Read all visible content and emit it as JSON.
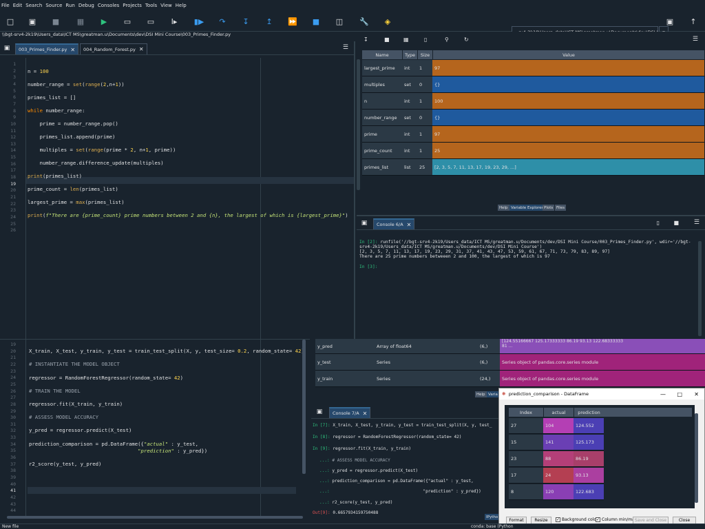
{
  "menu": [
    "File",
    "Edit",
    "Search",
    "Source",
    "Run",
    "Debug",
    "Consoles",
    "Projects",
    "Tools",
    "View",
    "Help"
  ],
  "toolbar": {
    "path": "...rv4-2k19\\Users_data\\ICT MS\\greatman.u\\Documents\\dev\\DSI Mini Course",
    "icons": [
      "new-file-icon",
      "open-folder-icon",
      "save-icon",
      "save-all-icon",
      "run-icon",
      "run-cell-icon",
      "run-cell-advance-icon",
      "run-selection-icon",
      "debug-icon",
      "step-icon",
      "step-into-icon",
      "step-return-icon",
      "continue-icon",
      "stop-icon",
      "maximize-pane-icon",
      "preferences-icon",
      "python-path-icon"
    ]
  },
  "breadcrumb": "\\\\bgt-srv4-2k19\\Users_data\\ICT MS\\greatman.u\\Documents\\dev\\DSI Mini Course\\003_Primes_Finder.py",
  "editor_top": {
    "tabs": [
      "003_Primes_Finder.py",
      "004_Random_Forest.py"
    ],
    "line_numbers": [
      "1",
      "2",
      "3",
      "4",
      "5",
      "6",
      "7",
      "8",
      "9",
      "10",
      "11",
      "12",
      "13",
      "14",
      "15",
      "16",
      "17",
      "18",
      "19",
      "20",
      "21",
      "22",
      "23",
      "24",
      "25",
      "26"
    ],
    "current_line": "19"
  },
  "editor_bottom": {
    "line_numbers": [
      "19",
      "20",
      "21",
      "22",
      "23",
      "24",
      "25",
      "26",
      "27",
      "28",
      "29",
      "30",
      "31",
      "32",
      "33",
      "34",
      "35",
      "36",
      "37",
      "38",
      "39",
      "40",
      "41",
      "42",
      "43",
      "44"
    ],
    "current_line": "41"
  },
  "var_explorer": {
    "toolbar_icons": [
      "import-data-icon",
      "save-data-icon",
      "save-as-icon",
      "delete-icon",
      "search-icon",
      "refresh-icon"
    ],
    "headers": [
      "Name",
      "Type",
      "Size",
      "Value"
    ],
    "rows": [
      {
        "name": "largest_prime",
        "type": "int",
        "size": "1",
        "value": "97",
        "color": "#b5651d"
      },
      {
        "name": "multiples",
        "type": "set",
        "size": "0",
        "value": "{}",
        "color": "#1f5a9e"
      },
      {
        "name": "n",
        "type": "int",
        "size": "1",
        "value": "100",
        "color": "#b5651d"
      },
      {
        "name": "number_range",
        "type": "set",
        "size": "0",
        "value": "{}",
        "color": "#1f5a9e"
      },
      {
        "name": "prime",
        "type": "int",
        "size": "1",
        "value": "97",
        "color": "#b5651d"
      },
      {
        "name": "prime_count",
        "type": "int",
        "size": "1",
        "value": "25",
        "color": "#b5651d"
      },
      {
        "name": "primes_list",
        "type": "list",
        "size": "25",
        "value": "[2, 3, 5, 7, 11, 13, 17, 19, 23, 29, ...]",
        "color": "#2e8fa8"
      }
    ],
    "pane_tabs": [
      "Help",
      "Variable Explorer",
      "Plots",
      "Files"
    ]
  },
  "console_top": {
    "tab": "Console 6/A",
    "line1_prompt": "In [2]:",
    "line1": "runfile('//bgt-srv4-2k19/Users_data/ICT MS/greatman.u/Documents/dev/DSI Mini Course/003_Primes_Finder.py', wdir='//bgt-",
    "line2": "srv4-2k19/Users_data/ICT MS/greatman.u/Documents/dev/DSI Mini Course')",
    "line3": "[2, 3, 5, 7, 11, 13, 17, 19, 23, 29, 31, 37, 41, 43, 47, 53, 59, 61, 67, 71, 73, 79, 83, 89, 97]",
    "line4": "There are 25 prime numbers betweeen 2 and 100, the largest of which is 97",
    "prompt3": "In [3]:"
  },
  "var_explorer2": {
    "rows": [
      {
        "name": "y_pred",
        "type": "Array of float64",
        "size": "(6,)",
        "value": "[124.55166667 125.17333333  86.19        93.13       122.68333333",
        "value2": "81 ..."
      },
      {
        "name": "y_test",
        "type": "Series",
        "size": "(6,)",
        "value": "Series object of pandas.core.series module"
      },
      {
        "name": "y_train",
        "type": "Series",
        "size": "(24,)",
        "value": "Series object of pandas.core.series module"
      }
    ],
    "pane_tabs": [
      "Help",
      "Varia"
    ]
  },
  "console_bottom": {
    "tab": "Console 7/A",
    "lines": [
      {
        "p": "In [7]:",
        "t": "X_train, X_test, y_train, y_test = train_test_split(X, y, test_"
      },
      {
        "p": "In [8]:",
        "t": "regressor = RandomForestRegressor(random_state= 42)"
      },
      {
        "p": "In [9]:",
        "t": "regressor.fit(X_train, y_train)"
      },
      {
        "p": "...:",
        "t": "# ASSESS MODEL ACCURACY"
      },
      {
        "p": "...:",
        "t": "y_pred = regressor.predict(X_test)"
      },
      {
        "p": "...:",
        "t": "prediction_comparison = pd.DataFrame({\"actual\" : y_test,"
      },
      {
        "p": "...:",
        "t": "                                    \"prediction\" : y_pred})"
      },
      {
        "p": "...:",
        "t": "r2_score(y_test, y_pred)"
      },
      {
        "p": "Out[9]:",
        "t": "0.6657934159750488"
      }
    ],
    "ipython_tab": "IPytho"
  },
  "dataframe": {
    "title": "prediction_comparison - DataFrame",
    "headers": [
      "Index",
      "actual",
      "prediction"
    ],
    "rows": [
      {
        "index": "27",
        "actual": "104",
        "prediction": "124.552",
        "ac": "#b43fb4",
        "pc": "#4b3fb4"
      },
      {
        "index": "15",
        "actual": "141",
        "prediction": "125.173",
        "ac": "#6a3fb4",
        "pc": "#4b3fb4"
      },
      {
        "index": "23",
        "actual": "88",
        "prediction": "86.19",
        "ac": "#b43f78",
        "pc": "#a83f6a"
      },
      {
        "index": "17",
        "actual": "24",
        "prediction": "93.13",
        "ac": "#b43f52",
        "pc": "#ab3fa0"
      },
      {
        "index": "8",
        "actual": "120",
        "prediction": "122.683",
        "ac": "#8a3fb4",
        "pc": "#4b3fb4"
      }
    ],
    "buttons": {
      "format": "Format",
      "resize": "Resize",
      "bg_color": "Background color",
      "col_minmax": "Column min/max",
      "save_close": "Save and Close",
      "close": "Close"
    }
  },
  "status": {
    "left": "New file",
    "right": "conda: base (Python"
  }
}
